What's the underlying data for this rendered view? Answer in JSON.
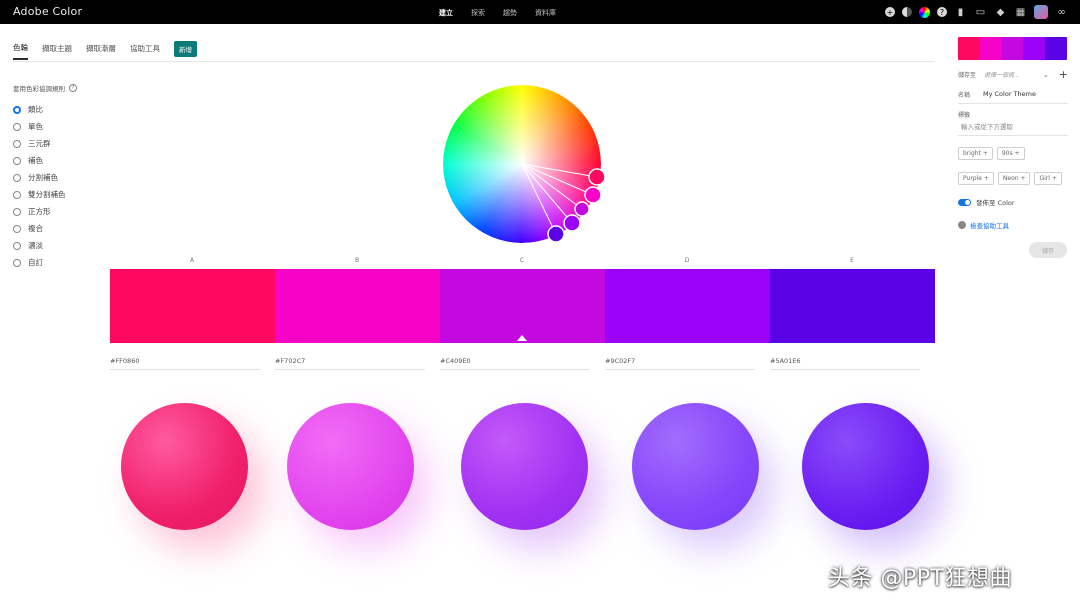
{
  "app": {
    "brand": "Adobe Color"
  },
  "topnav": {
    "items": [
      "建立",
      "探索",
      "趨勢",
      "資料庫"
    ]
  },
  "tabs": {
    "items": [
      "色輪",
      "擷取主題",
      "擷取漸層",
      "協助工具"
    ],
    "new_badge": "新增"
  },
  "harmony": {
    "title": "套用色彩協調規則",
    "help": "?",
    "rules": [
      "類比",
      "單色",
      "三元群",
      "補色",
      "分割補色",
      "雙分割補色",
      "正方形",
      "複合",
      "濃淡",
      "自訂"
    ],
    "selected": 0
  },
  "swatches": {
    "labels": [
      "A",
      "B",
      "C",
      "D",
      "E"
    ],
    "colors": [
      "#FF0860",
      "#F702C7",
      "#C409E0",
      "#9C02F7",
      "#5A01E6"
    ],
    "hex": [
      "#FF0860",
      "#F702C7",
      "#C409E0",
      "#9C02F7",
      "#5A01E6"
    ],
    "selected": 2
  },
  "right_panel": {
    "save_to_label": "儲存至",
    "save_to_placeholder": "選擇一個資...",
    "name_label": "名稱",
    "name_value": "My Color Theme",
    "tags_label": "標籤",
    "tags_placeholder": "輸入或從下方選取",
    "tags": [
      "bright +",
      "90s +",
      "Purple +",
      "Neon +",
      "Girl +"
    ],
    "publish_label": "發佈至 Color",
    "tools_link": "檢查協助工具",
    "save_button": "儲存"
  },
  "watermark": "头条 @PPT狂想曲",
  "colors": {
    "topbar": "#000000",
    "accent": "#1473e6",
    "badge": "#0d7a7a"
  }
}
